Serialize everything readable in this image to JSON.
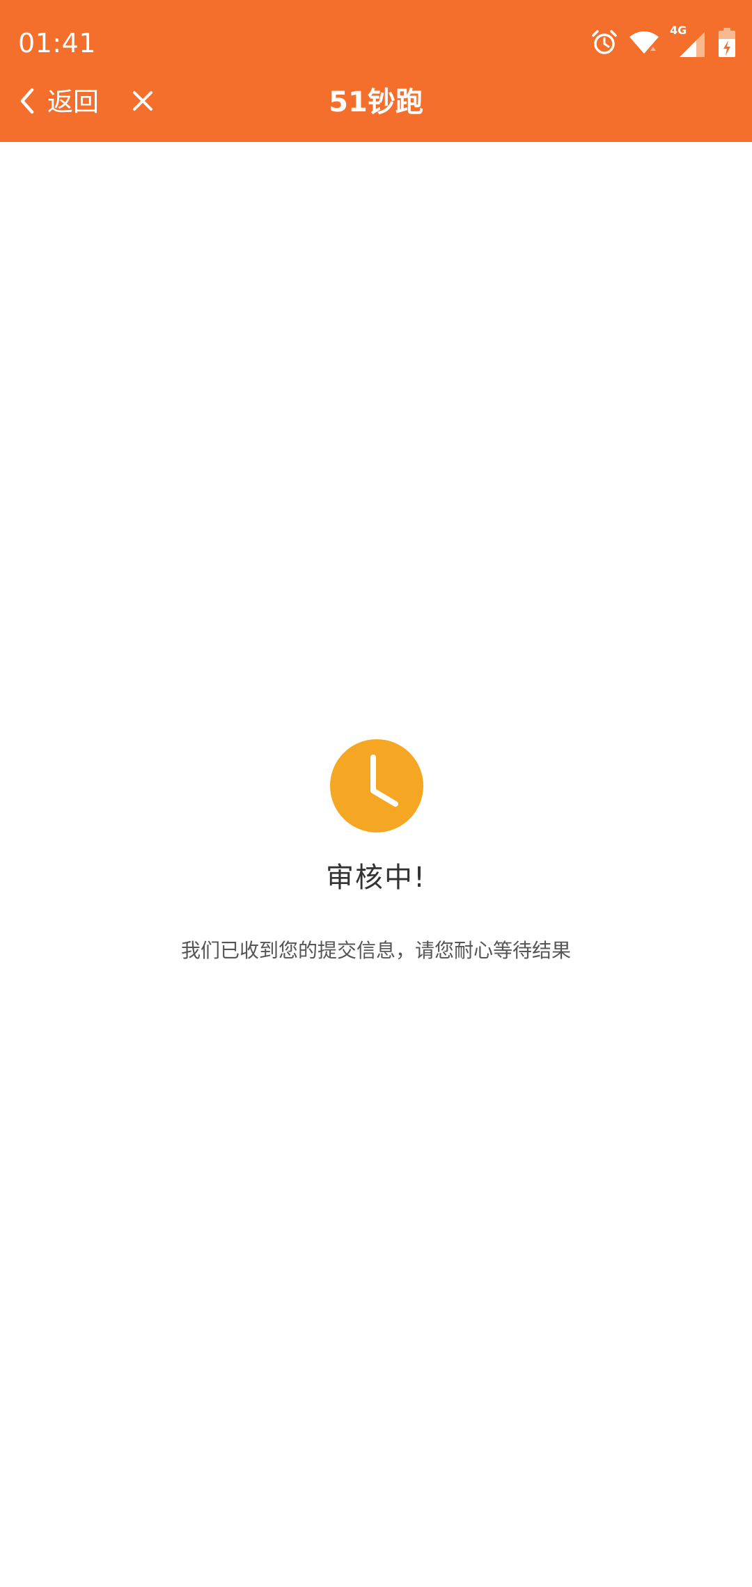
{
  "status_bar": {
    "time": "01:41",
    "network_label": "4G",
    "icons": [
      "alarm-icon",
      "wifi-icon",
      "signal-icon",
      "battery-charging-icon"
    ]
  },
  "nav": {
    "back_label": "返回",
    "title": "51钞跑",
    "back_icon": "chevron-left-icon",
    "close_icon": "close-icon"
  },
  "review": {
    "icon": "clock-icon",
    "heading": "审核中!",
    "message": "我们已收到您的提交信息，请您耐心等待结果"
  },
  "colors": {
    "accent": "#F56F2C",
    "clock": "#F5A623",
    "text_primary": "#333333",
    "text_secondary": "#555555",
    "background": "#FFFFFF"
  }
}
